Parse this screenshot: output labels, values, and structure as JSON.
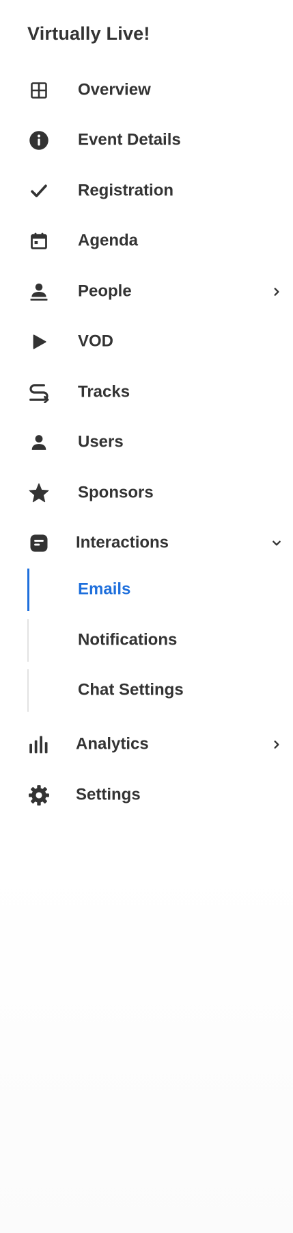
{
  "app": {
    "title": "Virtually Live!"
  },
  "colors": {
    "text": "#333333",
    "accent": "#1e6fdc",
    "rail": "#e2e2e2"
  },
  "nav": {
    "items": [
      {
        "label": "Overview",
        "icon": "grid-icon"
      },
      {
        "label": "Event Details",
        "icon": "info-icon"
      },
      {
        "label": "Registration",
        "icon": "check-icon"
      },
      {
        "label": "Agenda",
        "icon": "calendar-icon"
      },
      {
        "label": "People",
        "icon": "person-icon",
        "chevron": "right"
      },
      {
        "label": "VOD",
        "icon": "play-icon"
      },
      {
        "label": "Tracks",
        "icon": "tracks-icon"
      },
      {
        "label": "Users",
        "icon": "user-icon"
      },
      {
        "label": "Sponsors",
        "icon": "star-icon"
      },
      {
        "label": "Interactions",
        "icon": "chat-icon",
        "chevron": "down",
        "expanded": true
      },
      {
        "label": "Analytics",
        "icon": "bar-chart-icon",
        "chevron": "right"
      },
      {
        "label": "Settings",
        "icon": "gear-icon"
      }
    ],
    "interactions_sub": [
      {
        "label": "Emails",
        "active": true
      },
      {
        "label": "Notifications",
        "active": false
      },
      {
        "label": "Chat Settings",
        "active": false
      }
    ]
  }
}
